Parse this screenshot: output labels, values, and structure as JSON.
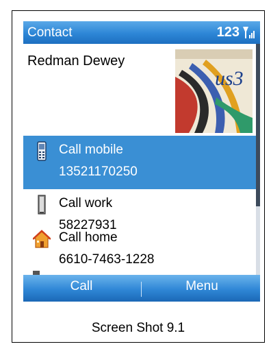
{
  "titlebar": {
    "title": "Contact",
    "input_mode": "123",
    "signal_icon": "signal-strength-icon"
  },
  "contact": {
    "name": "Redman Dewey",
    "photo_icon": "contact-photo"
  },
  "actions": [
    {
      "label": "Call mobile",
      "value": "13521170250",
      "icon": "mobile-phone-icon",
      "selected": true
    },
    {
      "label": "Call work",
      "value": "58227931",
      "icon": "work-phone-icon",
      "selected": false
    },
    {
      "label": "Call home",
      "value": "6610-7463-1228",
      "icon": "home-icon",
      "selected": false
    }
  ],
  "softkeys": {
    "left": "Call",
    "right": "Menu"
  },
  "caption": "Screen Shot 9.1",
  "colors": {
    "titlebar": "#2d86d6",
    "selection": "#3a8fd4",
    "scroll_thumb": "#3d4b5c"
  },
  "scroll": {
    "visible_fraction": 0.7
  }
}
